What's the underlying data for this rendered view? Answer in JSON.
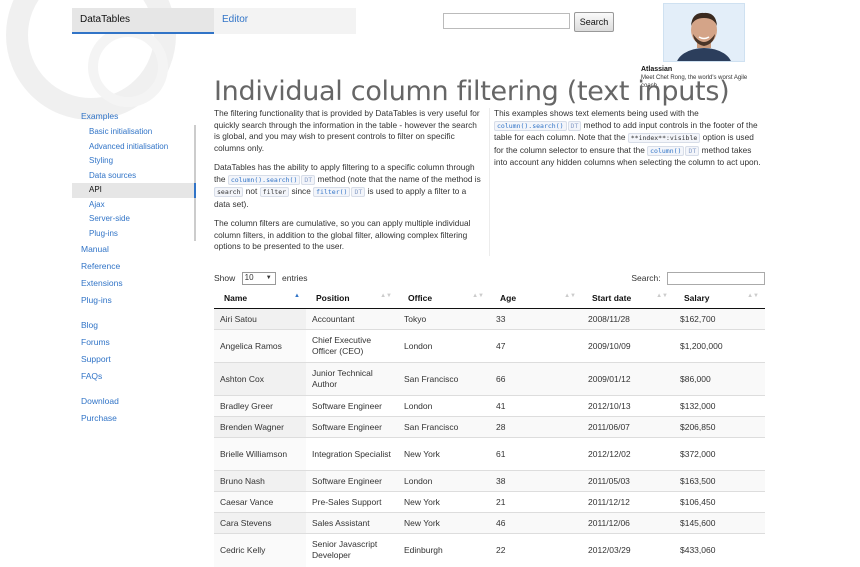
{
  "header": {
    "tabs": [
      "DataTables",
      "Editor"
    ],
    "search_button": "Search"
  },
  "ad": {
    "title": "Atlassian",
    "text": "Meet Chet Rong, the world's worst Agile coach."
  },
  "page_title": "Individual column filtering (text inputs)",
  "intro": {
    "p1": "The filtering functionality that is provided by DataTables is very useful for quickly search through the information in the table - however the search is global, and you may wish to present controls to filter on specific columns only.",
    "p2_a": "DataTables has the ability to apply filtering to a specific column through the",
    "p2_code1": "column().search()",
    "p2_dt": "DT",
    "p2_b": "method (note that the name of the method is",
    "p2_code2": "search",
    "p2_c": "not",
    "p2_code3": "filter",
    "p2_d": "since",
    "p2_code4": "filter()",
    "p2_e": "is used to apply a filter to a data set).",
    "p3": "The column filters are cumulative, so you can apply multiple individual column filters, in addition to the global filter, allowing complex filtering options to be presented to the user.",
    "r_a": "This examples shows text elements being used with the",
    "r_code1": "column().search()",
    "r_b": "method to add input controls in the footer of the table for each column. Note that the",
    "r_code2": "**index**:visible",
    "r_c": "option is used for the column selector to ensure that the",
    "r_code3": "column()",
    "r_d": "method takes into account any hidden columns when selecting the column to act upon."
  },
  "sidebar": {
    "examples": "Examples",
    "sub": [
      "Basic initialisation",
      "Advanced initialisation",
      "Styling",
      "Data sources",
      "API",
      "Ajax",
      "Server-side",
      "Plug-ins"
    ],
    "group1": [
      "Manual",
      "Reference",
      "Extensions",
      "Plug-ins"
    ],
    "group2": [
      "Blog",
      "Forums",
      "Support",
      "FAQs"
    ],
    "group3": [
      "Download",
      "Purchase"
    ]
  },
  "controls": {
    "show": "Show",
    "length_value": "10",
    "entries": "entries",
    "search_label": "Search:"
  },
  "table": {
    "headers": [
      "Name",
      "Position",
      "Office",
      "Age",
      "Start date",
      "Salary"
    ],
    "rows": [
      [
        "Airi Satou",
        "Accountant",
        "Tokyo",
        "33",
        "2008/11/28",
        "$162,700"
      ],
      [
        "Angelica Ramos",
        "Chief Executive Officer (CEO)",
        "London",
        "47",
        "2009/10/09",
        "$1,200,000"
      ],
      [
        "Ashton Cox",
        "Junior Technical Author",
        "San Francisco",
        "66",
        "2009/01/12",
        "$86,000"
      ],
      [
        "Bradley Greer",
        "Software Engineer",
        "London",
        "41",
        "2012/10/13",
        "$132,000"
      ],
      [
        "Brenden Wagner",
        "Software Engineer",
        "San Francisco",
        "28",
        "2011/06/07",
        "$206,850"
      ],
      [
        "Brielle Williamson",
        "Integration Specialist",
        "New York",
        "61",
        "2012/12/02",
        "$372,000"
      ],
      [
        "Bruno Nash",
        "Software Engineer",
        "London",
        "38",
        "2011/05/03",
        "$163,500"
      ],
      [
        "Caesar Vance",
        "Pre-Sales Support",
        "New York",
        "21",
        "2011/12/12",
        "$106,450"
      ],
      [
        "Cara Stevens",
        "Sales Assistant",
        "New York",
        "46",
        "2011/12/06",
        "$145,600"
      ],
      [
        "Cedric Kelly",
        "Senior Javascript Developer",
        "Edinburgh",
        "22",
        "2012/03/29",
        "$433,060"
      ]
    ]
  }
}
